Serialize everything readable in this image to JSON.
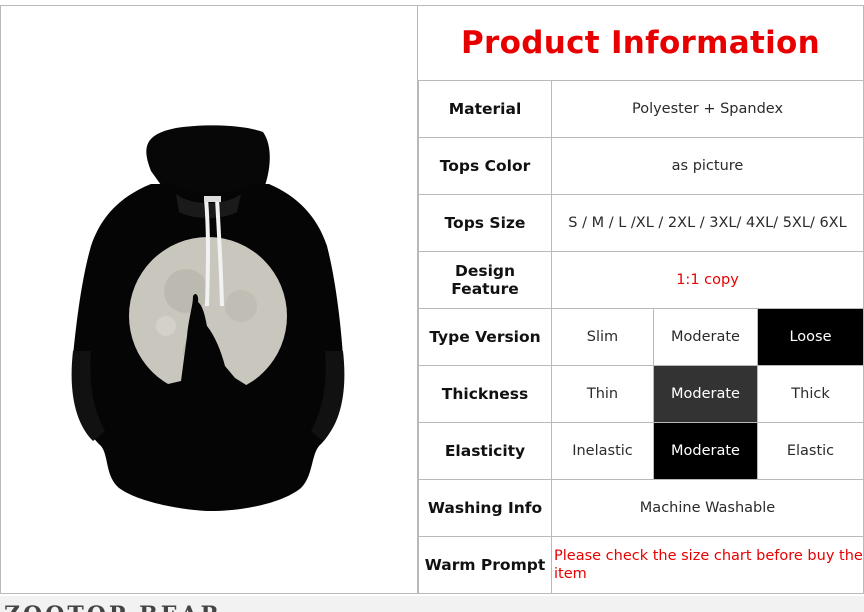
{
  "title": "Product Information",
  "rows": {
    "material": {
      "label": "Material",
      "value": "Polyester + Spandex"
    },
    "tops_color": {
      "label": "Tops Color",
      "value": "as picture"
    },
    "tops_size": {
      "label": "Tops Size",
      "value": "S / M / L /XL / 2XL / 3XL/ 4XL/ 5XL/ 6XL"
    },
    "design_feature": {
      "label": "Design Feature",
      "value": "1:1 copy"
    },
    "type_version": {
      "label": "Type Version",
      "options": [
        "Slim",
        "Moderate",
        "Loose"
      ],
      "selected": "Loose"
    },
    "thickness": {
      "label": "Thickness",
      "options": [
        "Thin",
        "Moderate",
        "Thick"
      ],
      "selected": "Moderate"
    },
    "elasticity": {
      "label": "Elasticity",
      "options": [
        "Inelastic",
        "Moderate",
        "Elastic"
      ],
      "selected": "Moderate"
    },
    "washing_info": {
      "label": "Washing Info",
      "value": "Machine Washable"
    },
    "warm_prompt": {
      "label": "Warm Prompt",
      "value": "Please check the size chart before buy the item"
    }
  },
  "bottom_strip_text": "ZOOTOP BEAR",
  "colors": {
    "title": "#e80000",
    "highlight": "#e80000",
    "selected": "#000000",
    "selected_alt": "#333333",
    "border": "#b9b9b9"
  }
}
